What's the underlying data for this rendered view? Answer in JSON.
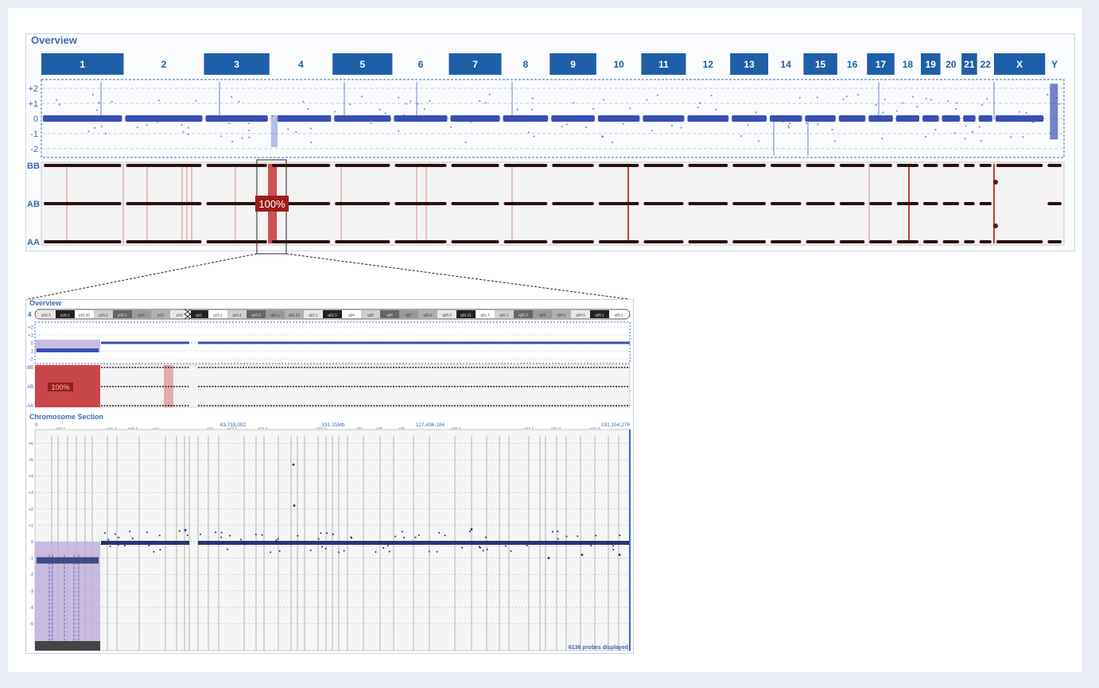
{
  "overview": {
    "title": "Overview",
    "chromosomes": [
      {
        "label": "1",
        "size": 249,
        "filled": true
      },
      {
        "label": "2",
        "size": 243,
        "filled": false
      },
      {
        "label": "3",
        "size": 198,
        "filled": true
      },
      {
        "label": "4",
        "size": 191,
        "filled": false
      },
      {
        "label": "5",
        "size": 181,
        "filled": true
      },
      {
        "label": "6",
        "size": 171,
        "filled": false
      },
      {
        "label": "7",
        "size": 159,
        "filled": true
      },
      {
        "label": "8",
        "size": 146,
        "filled": false
      },
      {
        "label": "9",
        "size": 141,
        "filled": true
      },
      {
        "label": "10",
        "size": 136,
        "filled": false
      },
      {
        "label": "11",
        "size": 135,
        "filled": true
      },
      {
        "label": "12",
        "size": 134,
        "filled": false
      },
      {
        "label": "13",
        "size": 115,
        "filled": true
      },
      {
        "label": "14",
        "size": 107,
        "filled": false
      },
      {
        "label": "15",
        "size": 102,
        "filled": true
      },
      {
        "label": "16",
        "size": 90,
        "filled": false
      },
      {
        "label": "17",
        "size": 83,
        "filled": true
      },
      {
        "label": "18",
        "size": 80,
        "filled": false
      },
      {
        "label": "19",
        "size": 59,
        "filled": true
      },
      {
        "label": "20",
        "size": 64,
        "filled": false
      },
      {
        "label": "21",
        "size": 47,
        "filled": true
      },
      {
        "label": "22",
        "size": 51,
        "filled": false
      },
      {
        "label": "X",
        "size": 155,
        "filled": true
      },
      {
        "label": "Y",
        "size": 57,
        "filled": false
      }
    ],
    "log2_ticks": [
      "+2",
      "+1",
      "0",
      "-1",
      "-2"
    ],
    "baf_ticks": [
      "BB",
      "AB",
      "AA"
    ],
    "selected_chromosome": "4",
    "selection_label": "100%",
    "loss_region": {
      "chromosome": "4",
      "start_fraction": 0.0,
      "end_fraction": 0.11,
      "log2": -1.0
    },
    "colors": {
      "chrom_fill": "#1f5fa8",
      "chrom_text_filled": "#ffffff",
      "chrom_text_empty": "#1f5fa8",
      "probe": "#3a4fb3",
      "baf_point": "#2b0f0f",
      "loh_line": "#c0282a",
      "axis_label": "#3b6bb0",
      "plot_bg": "#f3f3f3"
    }
  },
  "detail": {
    "title": "Overview",
    "chromosome_number": "4",
    "bands": [
      "p16.3",
      "p16.1",
      "p15.33",
      "p15.2",
      "p15.1",
      "p14",
      "p13",
      "p12",
      "q12",
      "q13.1",
      "q13.2",
      "q13.3",
      "q21.1",
      "q21.22",
      "q22.1",
      "q22.3",
      "q24",
      "q25",
      "q26",
      "q27",
      "q28.2",
      "q28.3",
      "q31.21",
      "q31.3",
      "q32.1",
      "q32.3",
      "q33",
      "q34.1",
      "q34.3",
      "q35.1",
      "q35.2"
    ],
    "log2_ticks": [
      "+2",
      "+1",
      "0",
      "1",
      "-2"
    ],
    "baf_ticks": [
      "BB",
      "AB",
      "AA"
    ],
    "selection_label": "100%"
  },
  "section": {
    "title": "Chromosome Section",
    "position_labels": [
      "0",
      "63,718,092",
      "191.15Mb",
      "127,436,184",
      "191,154,276"
    ],
    "band_labels": [
      "p16.1",
      "p15.2",
      "p15.1",
      "p14",
      "q12",
      "q13.1",
      "q13.3",
      "q22.1",
      "q24",
      "q25",
      "q26",
      "q28.3",
      "q32.1",
      "q32.3",
      "q34.3"
    ],
    "y_ticks": [
      "+6",
      "+5",
      "+4",
      "+3",
      "+2",
      "+1",
      "0",
      "-1",
      "-2",
      "-3",
      "-4",
      "-5"
    ],
    "footer": "6136 probes displayed",
    "y_range": [
      -6,
      7
    ]
  }
}
